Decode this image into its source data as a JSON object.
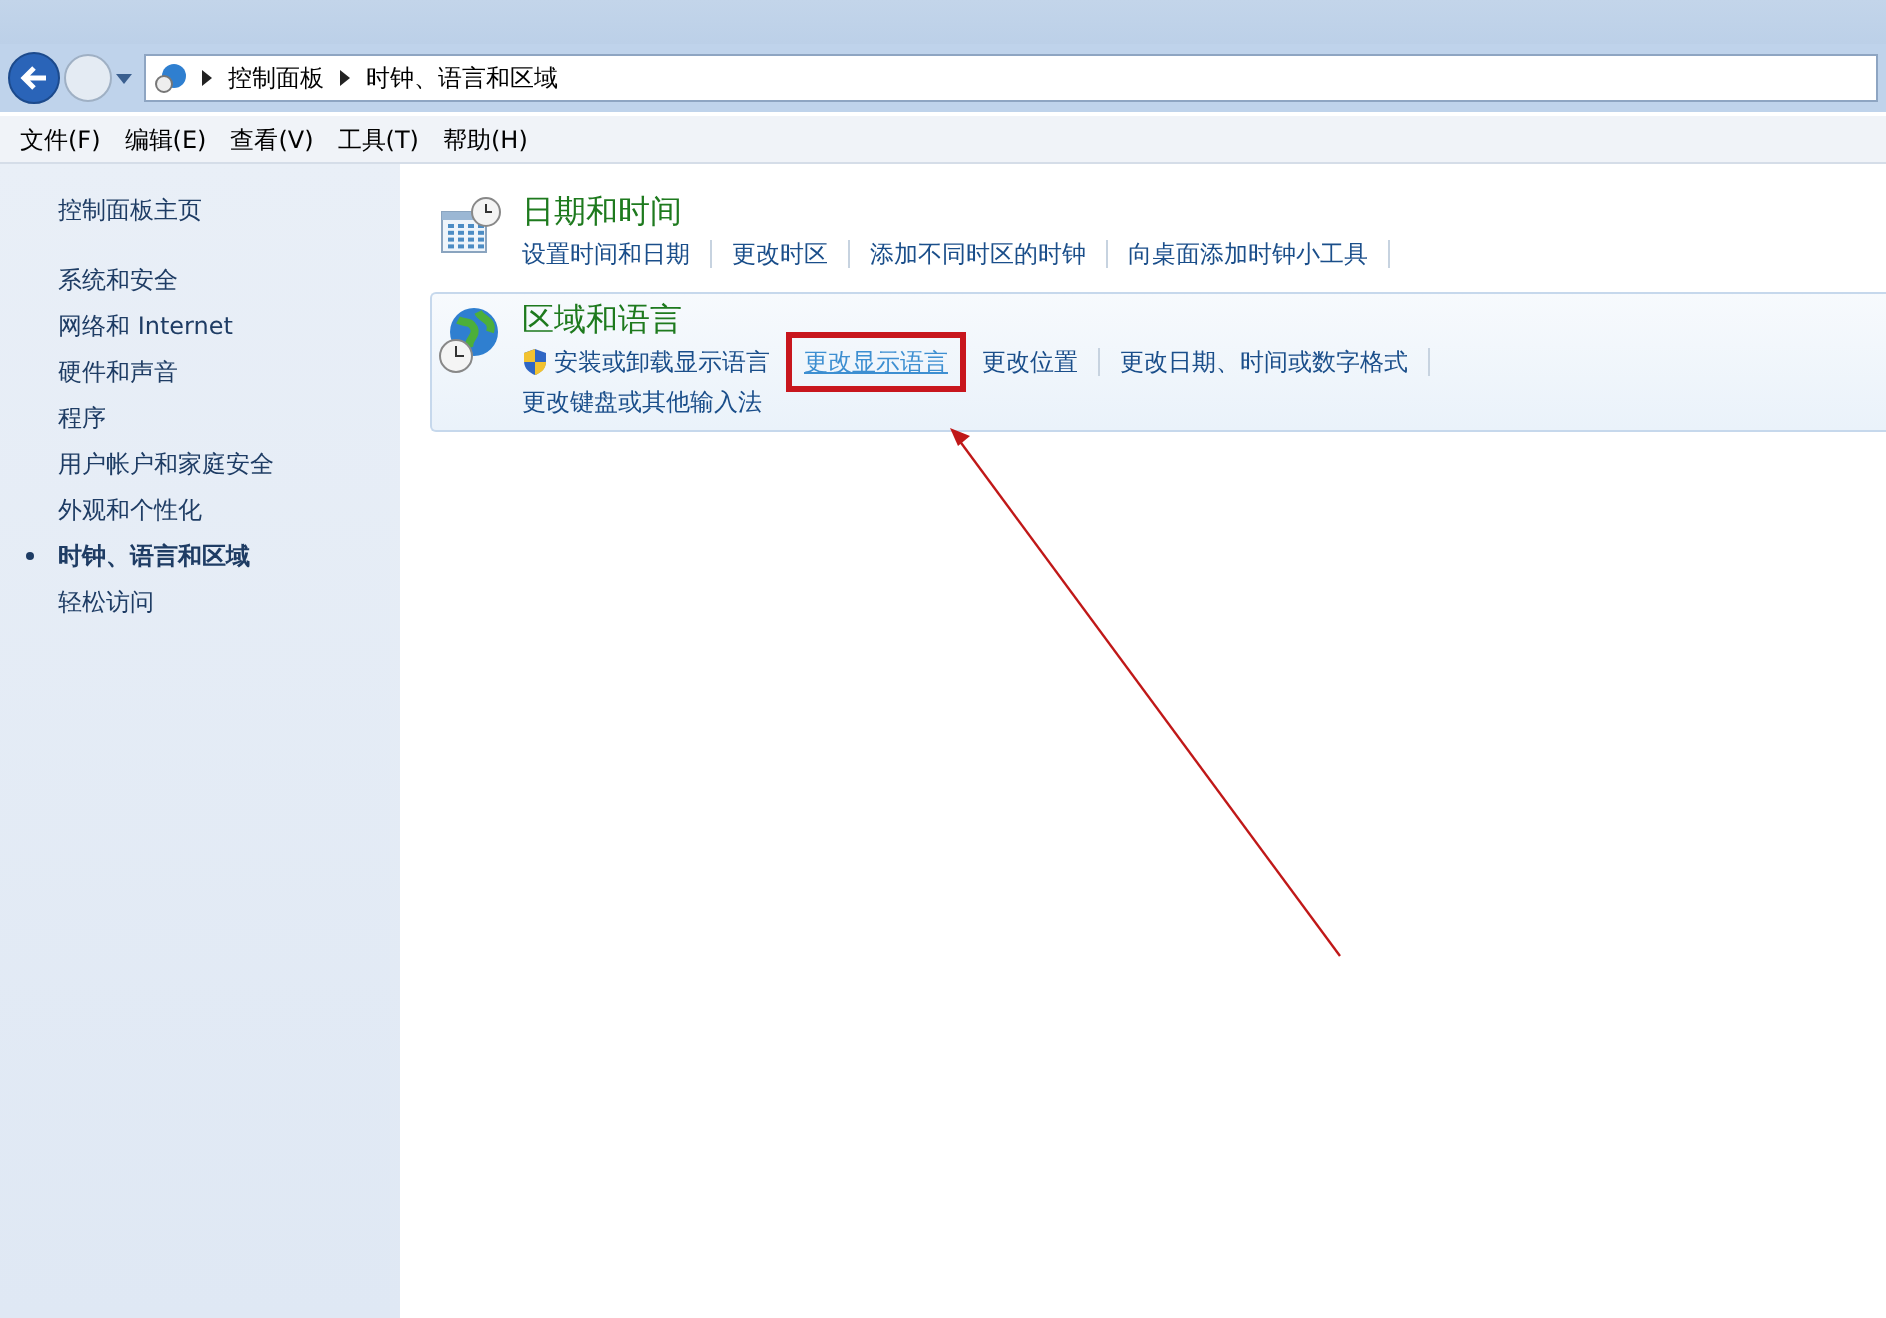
{
  "breadcrumb": [
    "控制面板",
    "时钟、语言和区域"
  ],
  "menu": [
    "文件(F)",
    "编辑(E)",
    "查看(V)",
    "工具(T)",
    "帮助(H)"
  ],
  "sidebar": {
    "home": "控制面板主页",
    "items": [
      {
        "label": "系统和安全",
        "selected": false
      },
      {
        "label": "网络和 Internet",
        "selected": false
      },
      {
        "label": "硬件和声音",
        "selected": false
      },
      {
        "label": "程序",
        "selected": false
      },
      {
        "label": "用户帐户和家庭安全",
        "selected": false
      },
      {
        "label": "外观和个性化",
        "selected": false
      },
      {
        "label": "时钟、语言和区域",
        "selected": true
      },
      {
        "label": "轻松访问",
        "selected": false
      }
    ]
  },
  "categories": [
    {
      "kind": "datetime",
      "title": "日期和时间",
      "highlighted": false,
      "link_rows": [
        [
          {
            "label": "设置时间和日期",
            "shield": false,
            "hovered": false,
            "boxed": false
          },
          {
            "label": "更改时区",
            "shield": false,
            "hovered": false,
            "boxed": false
          },
          {
            "label": "添加不同时区的时钟",
            "shield": false,
            "hovered": false,
            "boxed": false
          },
          {
            "label": "向桌面添加时钟小工具",
            "shield": false,
            "hovered": false,
            "boxed": false
          }
        ]
      ]
    },
    {
      "kind": "region",
      "title": "区域和语言",
      "highlighted": true,
      "link_rows": [
        [
          {
            "label": "安装或卸载显示语言",
            "shield": true,
            "hovered": false,
            "boxed": false
          },
          {
            "label": "更改显示语言",
            "shield": false,
            "hovered": true,
            "boxed": true
          },
          {
            "label": "更改位置",
            "shield": false,
            "hovered": false,
            "boxed": false
          },
          {
            "label": "更改日期、时间或数字格式",
            "shield": false,
            "hovered": false,
            "boxed": false
          }
        ],
        [
          {
            "label": "更改键盘或其他输入法",
            "shield": false,
            "hovered": false,
            "boxed": false
          }
        ]
      ]
    }
  ]
}
